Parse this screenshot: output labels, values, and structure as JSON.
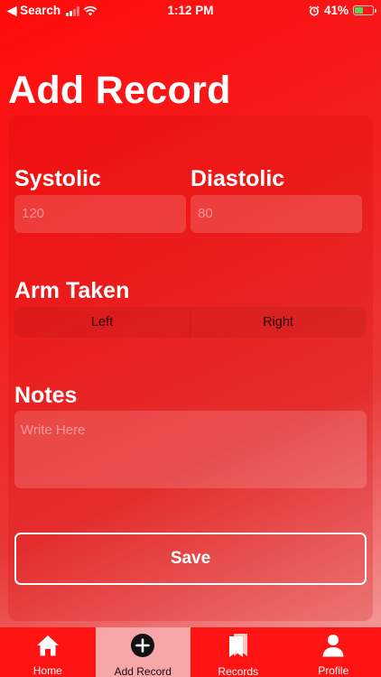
{
  "status_bar": {
    "back_label": "◀ Search",
    "time": "1:12 PM",
    "battery": "41%",
    "battery_level": 0.41
  },
  "page": {
    "title": "Add Record"
  },
  "form": {
    "systolic": {
      "label": "Systolic",
      "placeholder": "120"
    },
    "diastolic": {
      "label": "Diastolic",
      "placeholder": "80"
    },
    "arm": {
      "label": "Arm Taken",
      "options": [
        "Left",
        "Right"
      ]
    },
    "notes": {
      "label": "Notes",
      "placeholder": "Write Here"
    },
    "save_label": "Save"
  },
  "tab_bar": {
    "active": "Add Record",
    "items": [
      {
        "label": "Home",
        "icon": "house-icon"
      },
      {
        "label": "Add Record",
        "icon": "plus-circle-icon"
      },
      {
        "label": "Records",
        "icon": "bookmarks-icon"
      },
      {
        "label": "Profile",
        "icon": "person-icon"
      }
    ]
  },
  "colors": {
    "background_top": "#ff0b0b",
    "background_bottom": "#f4a9a9",
    "tab_bar": "#ff1313",
    "tab_active": "#f7a7a7"
  }
}
